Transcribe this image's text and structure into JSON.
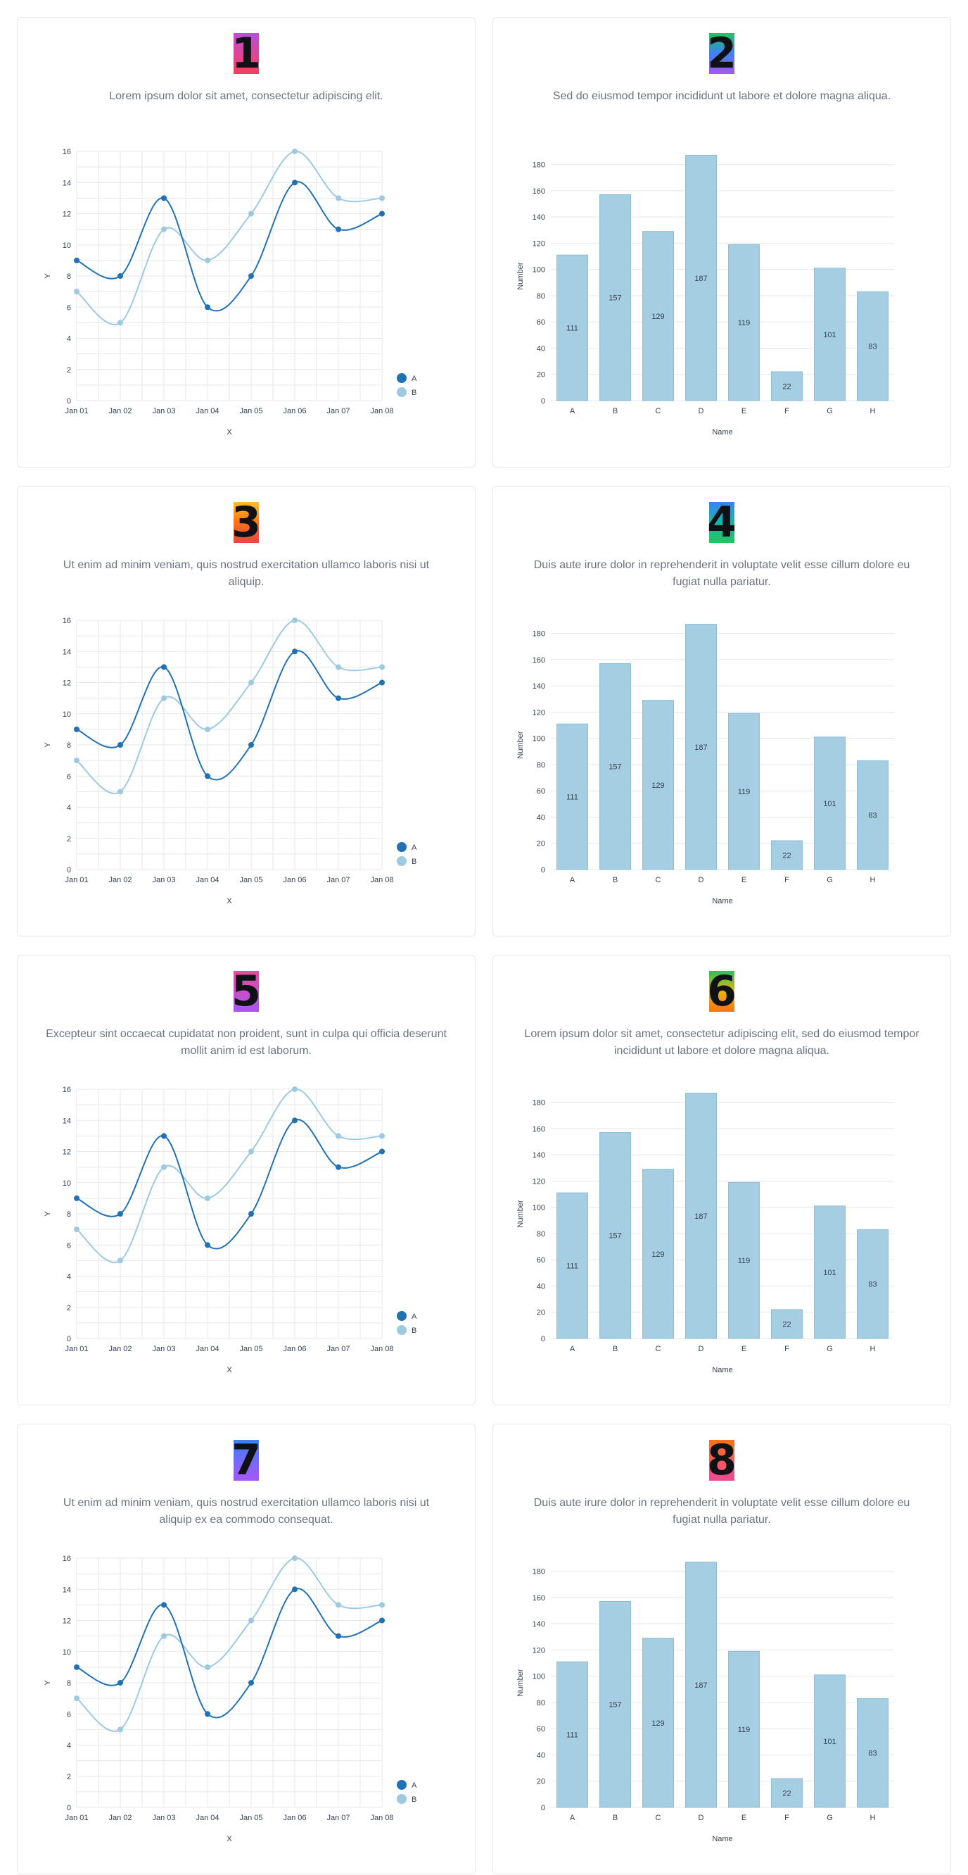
{
  "colors": {
    "series_a": "#2171b5",
    "series_b": "#9ecae1",
    "bar_fill": "#a6cee3",
    "bar_stroke": "#8bbcd6",
    "grid": "#e5e7eb",
    "axis_text": "#374151"
  },
  "cards": [
    {
      "number": "1",
      "gradient": [
        "#c24bd8",
        "#f43f5e"
      ],
      "description": "Lorem ipsum dolor sit amet, consectetur adipiscing elit.",
      "chart_data": {
        "type": "line",
        "x": [
          "Jan 01",
          "Jan 02",
          "Jan 03",
          "Jan 04",
          "Jan 05",
          "Jan 06",
          "Jan 07",
          "Jan 08"
        ],
        "series": [
          {
            "name": "A",
            "values": [
              9,
              8,
              13,
              6,
              8,
              14,
              11,
              12
            ]
          },
          {
            "name": "B",
            "values": [
              7,
              5,
              11,
              9,
              12,
              16,
              13,
              13
            ]
          }
        ],
        "ylim": [
          0,
          16
        ],
        "yticks": [
          0,
          2,
          4,
          6,
          8,
          10,
          12,
          14,
          16
        ],
        "xlabel": "X",
        "ylabel": "Y",
        "grid": true,
        "legend": "bottom-right"
      }
    },
    {
      "number": "2",
      "gradient": [
        "#22c55e",
        "#3b82f6",
        "#a855f7"
      ],
      "description": "Sed do eiusmod tempor incididunt ut labore et dolore magna aliqua.",
      "chart_data": {
        "type": "bar",
        "categories": [
          "A",
          "B",
          "C",
          "D",
          "E",
          "F",
          "G",
          "H"
        ],
        "values": [
          111,
          157,
          129,
          187,
          119,
          22,
          101,
          83
        ],
        "ylim": [
          0,
          190
        ],
        "yticks": [
          0,
          20,
          40,
          60,
          80,
          100,
          120,
          140,
          160,
          180
        ],
        "xlabel": "Name",
        "ylabel": "Number",
        "grid": true
      }
    },
    {
      "number": "3",
      "gradient": [
        "#fbbf24",
        "#f97316",
        "#ef4444"
      ],
      "description": "Ut enim ad minim veniam, quis nostrud exercitation ullamco laboris nisi ut aliquip.",
      "chart_data": {
        "type": "line",
        "x": [
          "Jan 01",
          "Jan 02",
          "Jan 03",
          "Jan 04",
          "Jan 05",
          "Jan 06",
          "Jan 07",
          "Jan 08"
        ],
        "series": [
          {
            "name": "A",
            "values": [
              9,
              8,
              13,
              6,
              8,
              14,
              11,
              12
            ]
          },
          {
            "name": "B",
            "values": [
              7,
              5,
              11,
              9,
              12,
              16,
              13,
              13
            ]
          }
        ],
        "ylim": [
          0,
          16
        ],
        "yticks": [
          0,
          2,
          4,
          6,
          8,
          10,
          12,
          14,
          16
        ],
        "xlabel": "X",
        "ylabel": "Y",
        "grid": true,
        "legend": "bottom-right"
      }
    },
    {
      "number": "4",
      "gradient": [
        "#3b82f6",
        "#14b8a6",
        "#22c55e"
      ],
      "description": "Duis aute irure dolor in reprehenderit in voluptate velit esse cillum dolore eu fugiat nulla pariatur.",
      "chart_data": {
        "type": "bar",
        "categories": [
          "A",
          "B",
          "C",
          "D",
          "E",
          "F",
          "G",
          "H"
        ],
        "values": [
          111,
          157,
          129,
          187,
          119,
          22,
          101,
          83
        ],
        "ylim": [
          0,
          190
        ],
        "yticks": [
          0,
          20,
          40,
          60,
          80,
          100,
          120,
          140,
          160,
          180
        ],
        "xlabel": "Name",
        "ylabel": "Number",
        "grid": true
      }
    },
    {
      "number": "5",
      "gradient": [
        "#ec4899",
        "#a855f7"
      ],
      "description": "Excepteur sint occaecat cupidatat non proident, sunt in culpa qui officia deserunt mollit anim id est laborum.",
      "chart_data": {
        "type": "line",
        "x": [
          "Jan 01",
          "Jan 02",
          "Jan 03",
          "Jan 04",
          "Jan 05",
          "Jan 06",
          "Jan 07",
          "Jan 08"
        ],
        "series": [
          {
            "name": "A",
            "values": [
              9,
              8,
              13,
              6,
              8,
              14,
              11,
              12
            ]
          },
          {
            "name": "B",
            "values": [
              7,
              5,
              11,
              9,
              12,
              16,
              13,
              13
            ]
          }
        ],
        "ylim": [
          0,
          16
        ],
        "yticks": [
          0,
          2,
          4,
          6,
          8,
          10,
          12,
          14,
          16
        ],
        "xlabel": "X",
        "ylabel": "Y",
        "grid": true,
        "legend": "bottom-right"
      }
    },
    {
      "number": "6",
      "gradient": [
        "#22c55e",
        "#eab308",
        "#f97316"
      ],
      "description": "Lorem ipsum dolor sit amet, consectetur adipiscing elit, sed do eiusmod tempor incididunt ut labore et dolore magna aliqua.",
      "chart_data": {
        "type": "bar",
        "categories": [
          "A",
          "B",
          "C",
          "D",
          "E",
          "F",
          "G",
          "H"
        ],
        "values": [
          111,
          157,
          129,
          187,
          119,
          22,
          101,
          83
        ],
        "ylim": [
          0,
          190
        ],
        "yticks": [
          0,
          20,
          40,
          60,
          80,
          100,
          120,
          140,
          160,
          180
        ],
        "xlabel": "Name",
        "ylabel": "Number",
        "grid": true
      }
    },
    {
      "number": "7",
      "gradient": [
        "#3b82f6",
        "#a855f7"
      ],
      "description": "Ut enim ad minim veniam, quis nostrud exercitation ullamco laboris nisi ut aliquip ex ea commodo consequat.",
      "chart_data": {
        "type": "line",
        "x": [
          "Jan 01",
          "Jan 02",
          "Jan 03",
          "Jan 04",
          "Jan 05",
          "Jan 06",
          "Jan 07",
          "Jan 08"
        ],
        "series": [
          {
            "name": "A",
            "values": [
              9,
              8,
              13,
              6,
              8,
              14,
              11,
              12
            ]
          },
          {
            "name": "B",
            "values": [
              7,
              5,
              11,
              9,
              12,
              16,
              13,
              13
            ]
          }
        ],
        "ylim": [
          0,
          16
        ],
        "yticks": [
          0,
          2,
          4,
          6,
          8,
          10,
          12,
          14,
          16
        ],
        "xlabel": "X",
        "ylabel": "Y",
        "grid": true,
        "legend": "bottom-right"
      }
    },
    {
      "number": "8",
      "gradient": [
        "#f97316",
        "#ec4899"
      ],
      "description": "Duis aute irure dolor in reprehenderit in voluptate velit esse cillum dolore eu fugiat nulla pariatur.",
      "chart_data": {
        "type": "bar",
        "categories": [
          "A",
          "B",
          "C",
          "D",
          "E",
          "F",
          "G",
          "H"
        ],
        "values": [
          111,
          157,
          129,
          187,
          119,
          22,
          101,
          83
        ],
        "ylim": [
          0,
          190
        ],
        "yticks": [
          0,
          20,
          40,
          60,
          80,
          100,
          120,
          140,
          160,
          180
        ],
        "xlabel": "Name",
        "ylabel": "Number",
        "grid": true
      }
    }
  ]
}
